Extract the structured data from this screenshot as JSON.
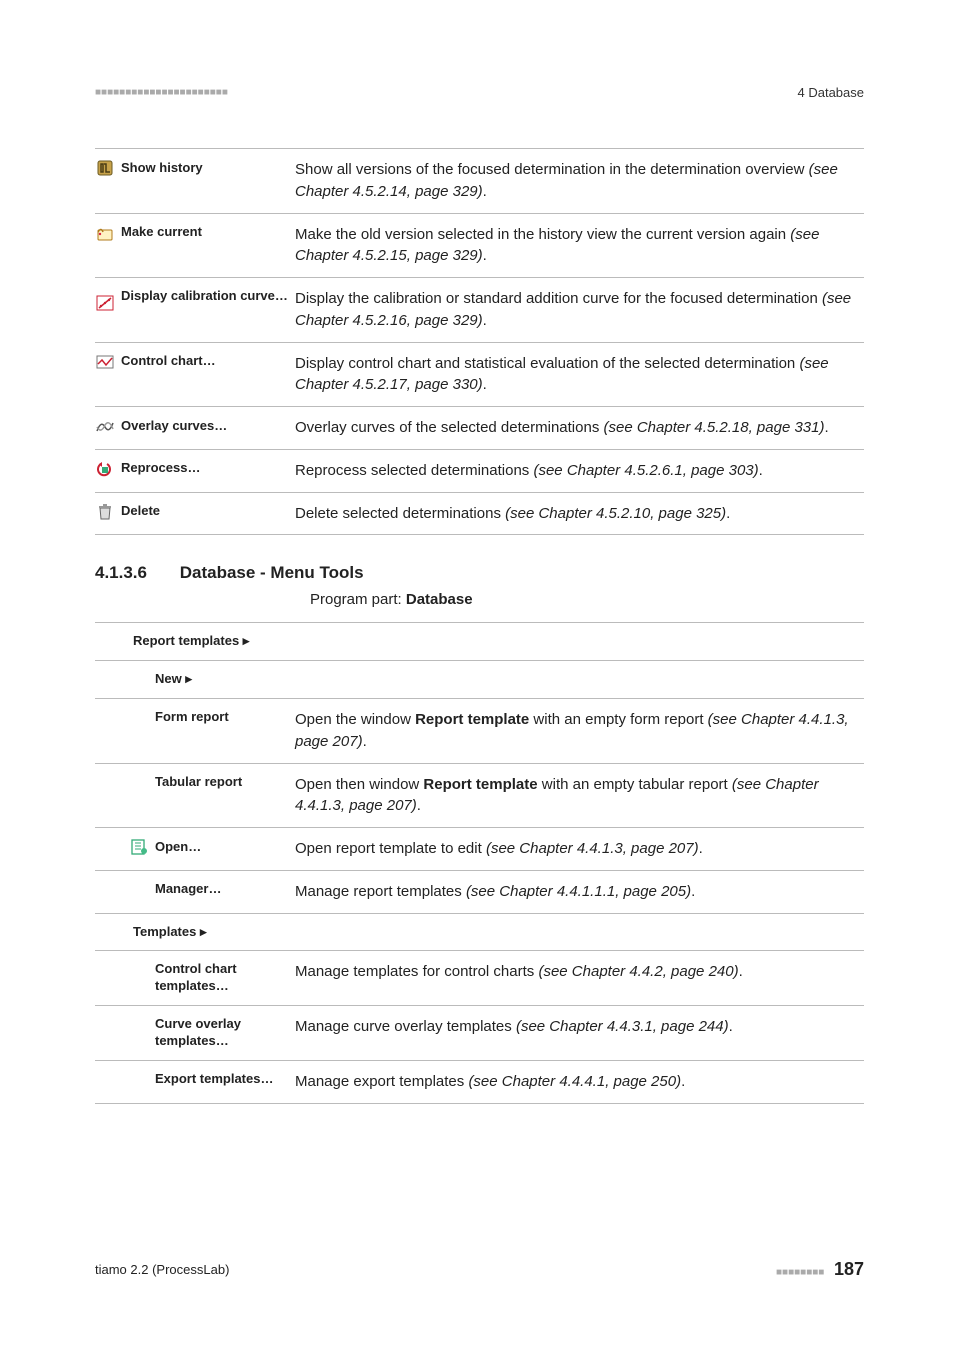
{
  "header": {
    "right": "4 Database"
  },
  "table1": [
    {
      "icon": "history",
      "label": "Show history",
      "desc": [
        "Show all versions of the focused determination in the determination overview ",
        "(see Chapter 4.5.2.14, page 329)",
        "."
      ]
    },
    {
      "icon": "makecurrent",
      "label": "Make current",
      "desc": [
        "Make the old version selected in the history view the current version again ",
        "(see Chapter 4.5.2.15, page 329)",
        "."
      ]
    },
    {
      "icon": "calibration",
      "label": "Display calibration curve…",
      "desc": [
        "Display the calibration or standard addition curve for the focused determination ",
        "(see Chapter 4.5.2.16, page 329)",
        "."
      ]
    },
    {
      "icon": "controlchart",
      "label": "Control chart…",
      "desc": [
        "Display control chart and statistical evaluation of the selected determination ",
        "(see Chapter 4.5.2.17, page 330)",
        "."
      ]
    },
    {
      "icon": "overlay",
      "label": "Overlay curves…",
      "desc": [
        "Overlay curves of the selected determinations ",
        "(see Chapter 4.5.2.18, page 331)",
        "."
      ]
    },
    {
      "icon": "reprocess",
      "label": "Reprocess…",
      "desc": [
        "Reprocess selected determinations ",
        "(see Chapter 4.5.2.6.1, page 303)",
        "."
      ]
    },
    {
      "icon": "delete",
      "label": "Delete",
      "desc": [
        "Delete selected determinations ",
        "(see Chapter 4.5.2.10, page 325)",
        "."
      ]
    }
  ],
  "section": {
    "num": "4.1.3.6",
    "title": "Database - Menu Tools",
    "program_prefix": "Program part: ",
    "program_bold": "Database"
  },
  "table2": {
    "report_templates": "Report templates ▸",
    "new": "New ▸",
    "form_report_label": "Form report",
    "form_report_desc_pre": "Open the window ",
    "form_report_desc_bold": "Report template",
    "form_report_desc_mid": " with an empty form report ",
    "form_report_desc_ital": "(see Chapter 4.4.1.3, page 207)",
    "tabular_label": "Tabular report",
    "tabular_desc_pre": "Open then window ",
    "tabular_desc_bold": "Report template",
    "tabular_desc_mid": " with an empty tabular report ",
    "tabular_desc_ital": "(see Chapter 4.4.1.3, page 207)",
    "open_label": "Open…",
    "open_desc": "Open report template to edit ",
    "open_desc_ital": "(see Chapter 4.4.1.3, page 207)",
    "manager_label": "Manager…",
    "manager_desc": "Manage report templates ",
    "manager_desc_ital": "(see Chapter 4.4.1.1.1, page 205)",
    "templates": "Templates ▸",
    "cc_label": "Control chart templates…",
    "cc_desc": "Manage templates for control charts ",
    "cc_desc_ital": "(see Chapter 4.4.2, page 240)",
    "co_label": "Curve overlay templates…",
    "co_desc": "Manage curve overlay templates ",
    "co_desc_ital": "(see Chapter 4.4.3.1, page 244)",
    "et_label": "Export templates…",
    "et_desc": "Manage export templates ",
    "et_desc_ital": "(see Chapter 4.4.4.1, page 250)"
  },
  "footer": {
    "left": "tiamo 2.2 (ProcessLab)",
    "page": "187"
  }
}
